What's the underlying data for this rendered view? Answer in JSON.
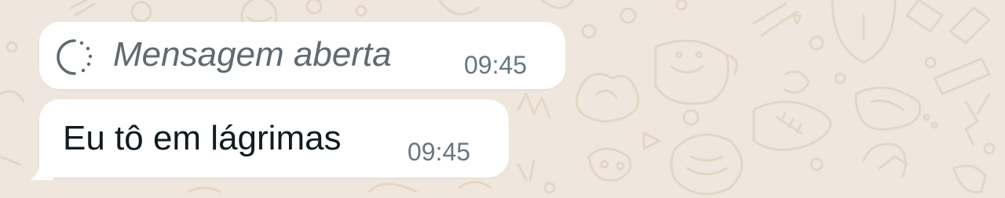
{
  "messages": [
    {
      "type": "view-once",
      "text": "Mensagem aberta",
      "time": "09:45",
      "icon": "view-once-opened-icon"
    },
    {
      "type": "incoming",
      "text": "Eu tô em lágrimas",
      "time": "09:45"
    }
  ],
  "colors": {
    "wallpaper": "#efe7dd",
    "doodle": "#e3d6c6",
    "bubble": "#ffffff",
    "text": "#111b21",
    "italic_text": "#5f6a70",
    "time": "#667781"
  }
}
